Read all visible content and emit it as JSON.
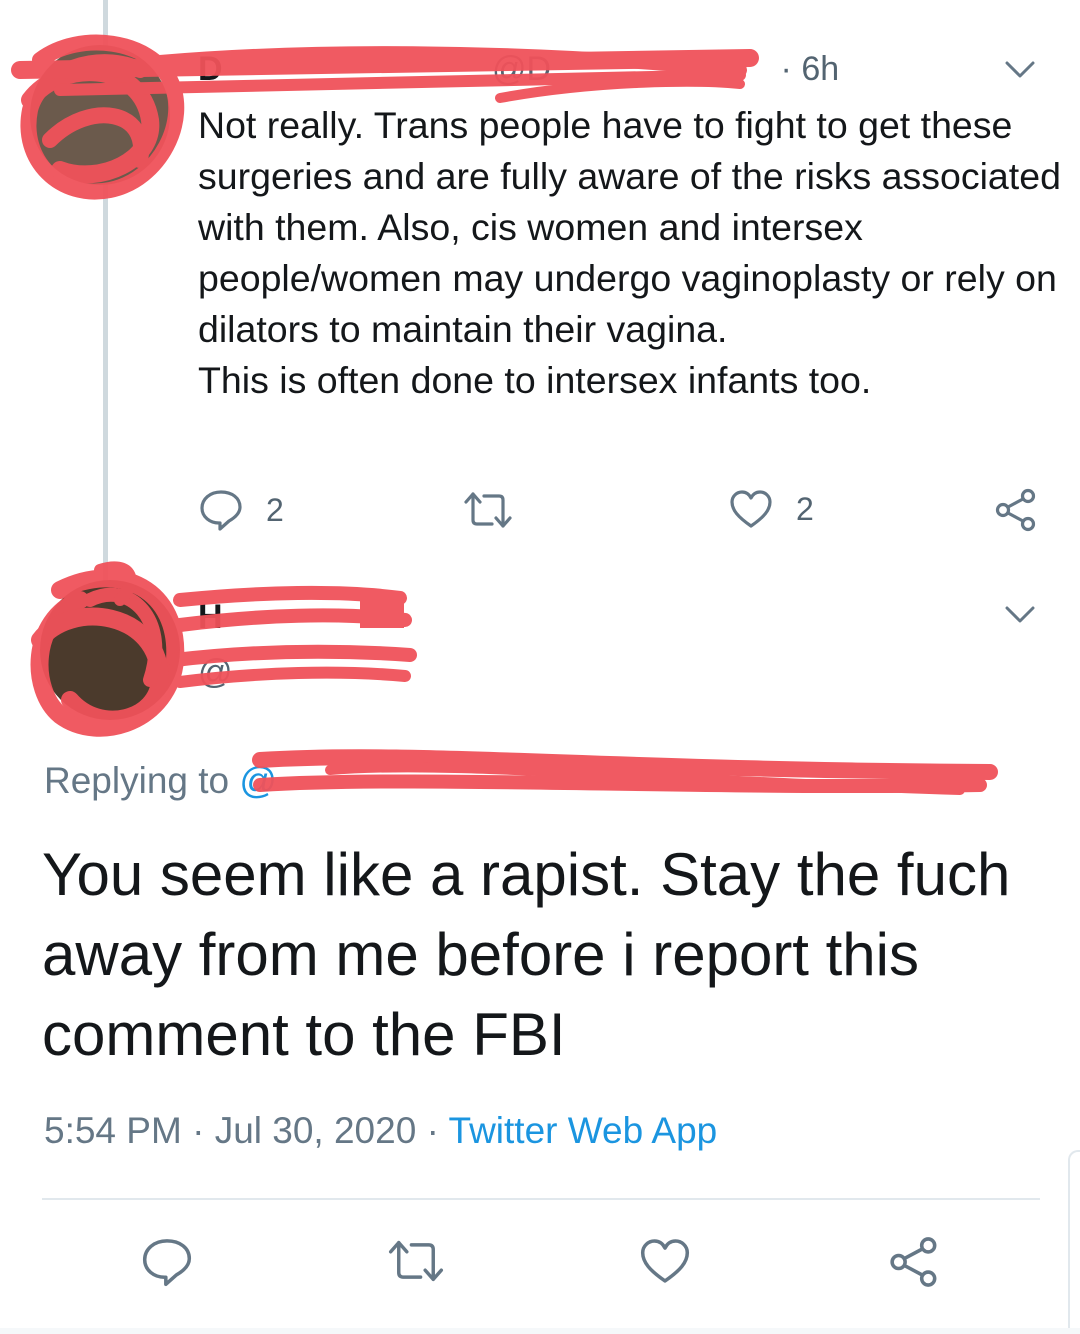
{
  "tweet1": {
    "name": "D",
    "handle": "@D",
    "time": "· 6h",
    "body_lines": [
      "Not really. Trans people have to fight to get these surgeries and are fully aware of the risks associated with them. Also, cis women and intersex people/women may undergo vaginoplasty or rely on dilators to maintain their vagina.",
      "This is often done to intersex infants too."
    ],
    "reply_count": "2",
    "like_count": "2"
  },
  "tweet2": {
    "name": "H",
    "handle": "@",
    "replying_prefix": "Replying to ",
    "replying_handle": "@",
    "text": "You seem like a rapist. Stay the fuch away from me before i report this comment to the FBI",
    "time": "5:54 PM",
    "separator": " · ",
    "date": "Jul 30, 2020",
    "source": "Twitter Web App"
  },
  "colors": {
    "redaction": "#f0525a",
    "thread_line": "#cfd9de",
    "secondary_text": "#657786",
    "link": "#1b95e0"
  },
  "icons": {
    "reply": "reply-icon",
    "retweet": "retweet-icon",
    "like": "heart-icon",
    "share": "share-icon",
    "menu": "chevron-down-icon"
  }
}
